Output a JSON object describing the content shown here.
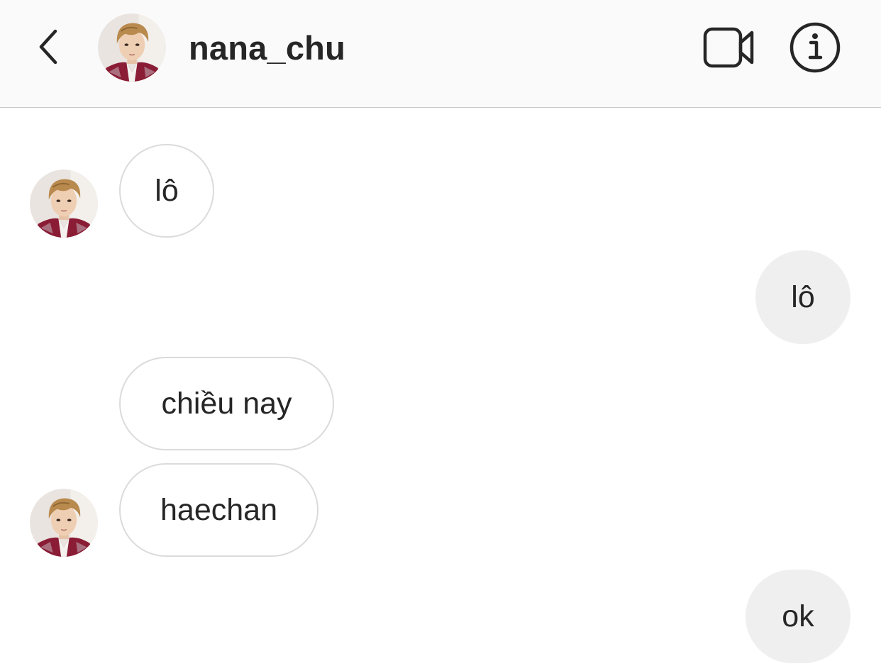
{
  "header": {
    "username": "nana_chu",
    "back_icon": "chevron-left-icon",
    "video_icon": "video-call-icon",
    "info_icon": "info-icon"
  },
  "messages": [
    {
      "sender": "nana_chu",
      "direction": "incoming",
      "text": "lô",
      "show_avatar": true
    },
    {
      "sender": "me",
      "direction": "outgoing",
      "text": "lô"
    },
    {
      "sender": "nana_chu",
      "direction": "incoming",
      "text": "chiều nay",
      "show_avatar": false
    },
    {
      "sender": "nana_chu",
      "direction": "incoming",
      "text": "haechan",
      "show_avatar": true
    },
    {
      "sender": "me",
      "direction": "outgoing",
      "text": "ok"
    }
  ],
  "colors": {
    "header_bg": "#fafafa",
    "text": "#262626",
    "incoming_border": "#dbdbdb",
    "outgoing_bg": "#efefef",
    "avatar_jacket": "#8a1c36",
    "avatar_hair": "#b98a4e"
  }
}
